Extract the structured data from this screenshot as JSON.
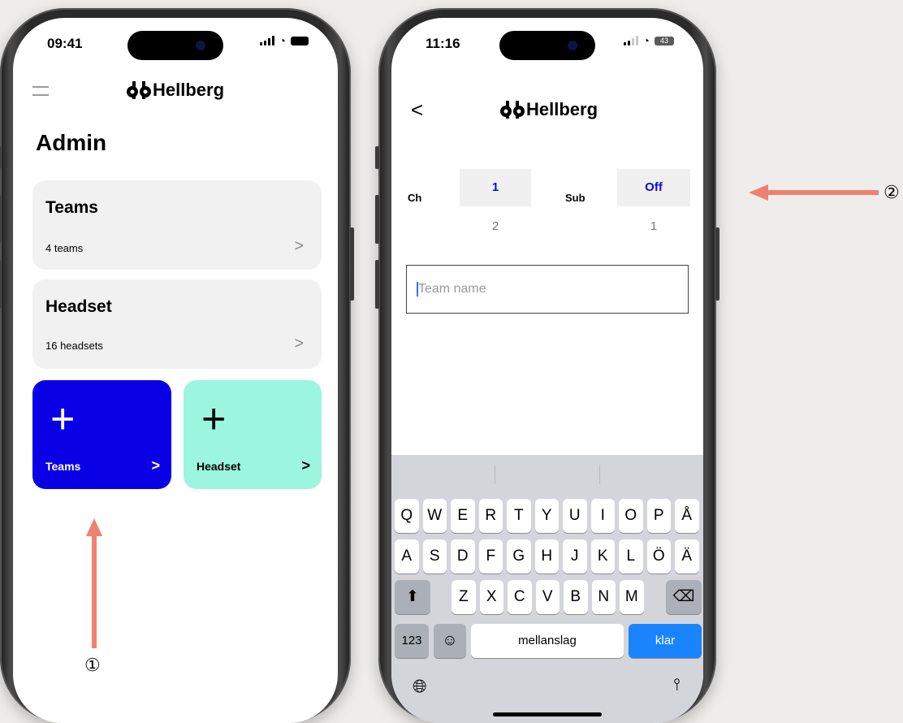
{
  "phone1": {
    "time": "09:41",
    "brand": "Hellberg",
    "page_title": "Admin",
    "cards": [
      {
        "title": "Teams",
        "subtitle": "4 teams",
        "chevron": ">"
      },
      {
        "title": "Headset",
        "subtitle": "16 headsets",
        "chevron": ">"
      }
    ],
    "tiles": [
      {
        "plus": "+",
        "label": "Teams",
        "chevron": ">",
        "color": "#0a00e6",
        "text_color": "#ffffff"
      },
      {
        "plus": "+",
        "label": "Headset",
        "chevron": ">",
        "color": "#9cf5df",
        "text_color": "#000000"
      }
    ]
  },
  "phone2": {
    "time": "11:16",
    "battery": "43",
    "brand": "Hellberg",
    "back": "<",
    "picker": {
      "ch_label": "Ch",
      "ch_value": "1",
      "ch_next": "2",
      "sub_label": "Sub",
      "sub_value": "Off",
      "sub_next": "1"
    },
    "team_name_placeholder": "Team name",
    "keyboard": {
      "row1": [
        "Q",
        "W",
        "E",
        "R",
        "T",
        "Y",
        "U",
        "I",
        "O",
        "P",
        "Å"
      ],
      "row2": [
        "A",
        "S",
        "D",
        "F",
        "G",
        "H",
        "J",
        "K",
        "L",
        "Ö",
        "Ä"
      ],
      "row3": [
        "Z",
        "X",
        "C",
        "V",
        "B",
        "N",
        "M"
      ],
      "numbers": "123",
      "space": "mellanslag",
      "done": "klar"
    }
  },
  "annotations": {
    "one": "①",
    "two": "②",
    "arrow_color": "#f08070"
  }
}
